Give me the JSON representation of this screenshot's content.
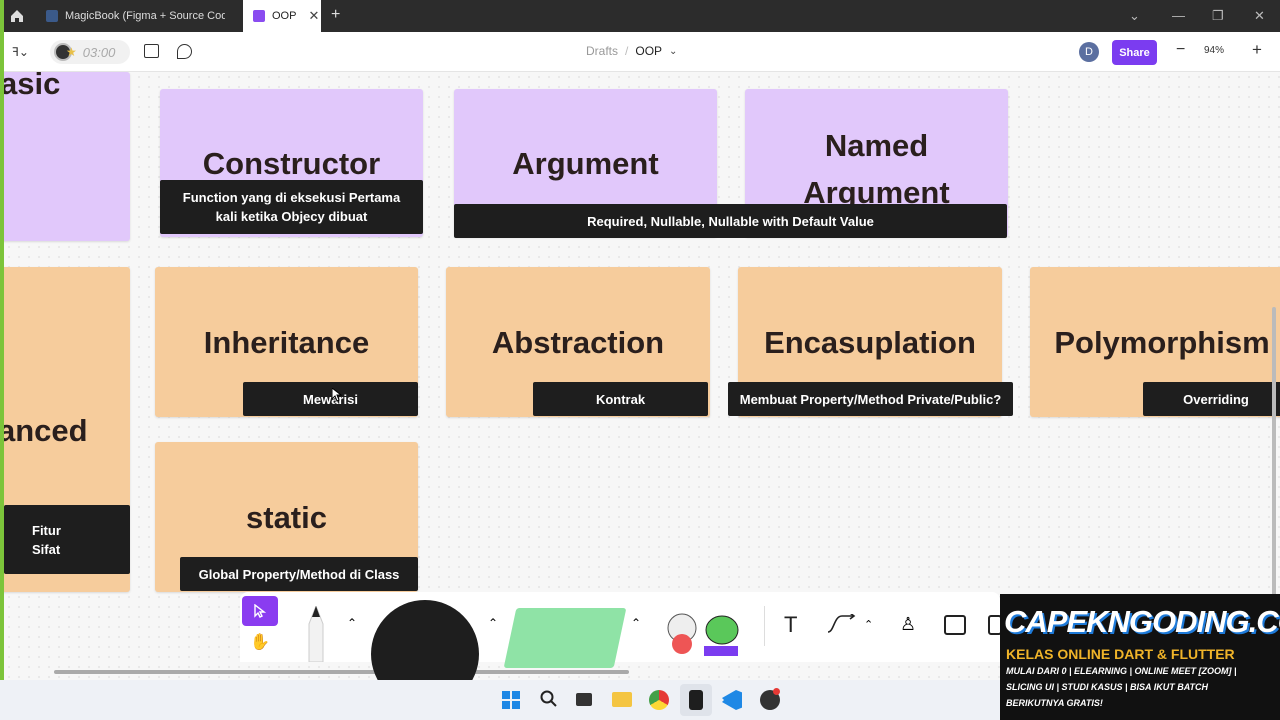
{
  "browser": {
    "tabs": [
      {
        "label": "MagicBook (Figma + Source Code kh"
      },
      {
        "label": "OOP"
      }
    ]
  },
  "toolbar": {
    "timer": "03:00",
    "breadcrumb_drafts": "Drafts",
    "breadcrumb_sep": "/",
    "file_name": "OOP",
    "avatar": "D",
    "share": "Share",
    "zoom": "94%"
  },
  "cards": {
    "basic": "asic",
    "constructor": "Constructor",
    "constructor_note": "Function yang di eksekusi Pertama kali ketika Objecy dibuat",
    "argument": "Argument",
    "named_argument": "Named Argument",
    "argument_note": "Required, Nullable, Nullable with Default Value",
    "advanced": "anced",
    "advanced_note_1": "Fitur",
    "advanced_note_2": "Sifat",
    "inheritance": "Inheritance",
    "inheritance_note": "Mewarisi",
    "abstraction": "Abstraction",
    "abstraction_note": "Kontrak",
    "encapsulation": "Encasuplation",
    "encapsulation_note": "Membuat Property/Method Private/Public?",
    "polymorphism": "Polymorphism",
    "polymorphism_note": "Overriding",
    "static": "static",
    "static_note": "Global Property/Method di Class"
  },
  "promo": {
    "brand": "CAPEKNGODING.COM",
    "headline": "KELAS ONLINE DART & FLUTTER",
    "line1": "MULAI DARI 0 | ELEARNING | ONLINE MEET [ZOOM] |",
    "line2": "SLICING UI | STUDI KASUS | BISA IKUT BATCH",
    "line3": "BERIKUTNYA GRATIS!"
  },
  "colors": {
    "accent": "#7b3cf0",
    "purple_card": "#e1c8fb",
    "orange_card": "#f6cc9c",
    "note": "#1e1e1e"
  },
  "icons": [
    "home-icon",
    "figma-menu-icon",
    "layout-icon",
    "comment-icon",
    "minus-icon",
    "plus-icon",
    "cursor-icon",
    "hand-icon",
    "pencil-icon",
    "text-icon",
    "connector-icon",
    "stamp-icon",
    "section-icon",
    "table-icon",
    "windows-start-icon",
    "search-icon",
    "file-explorer-icon",
    "chrome-icon",
    "figma-icon",
    "vscode-icon"
  ]
}
